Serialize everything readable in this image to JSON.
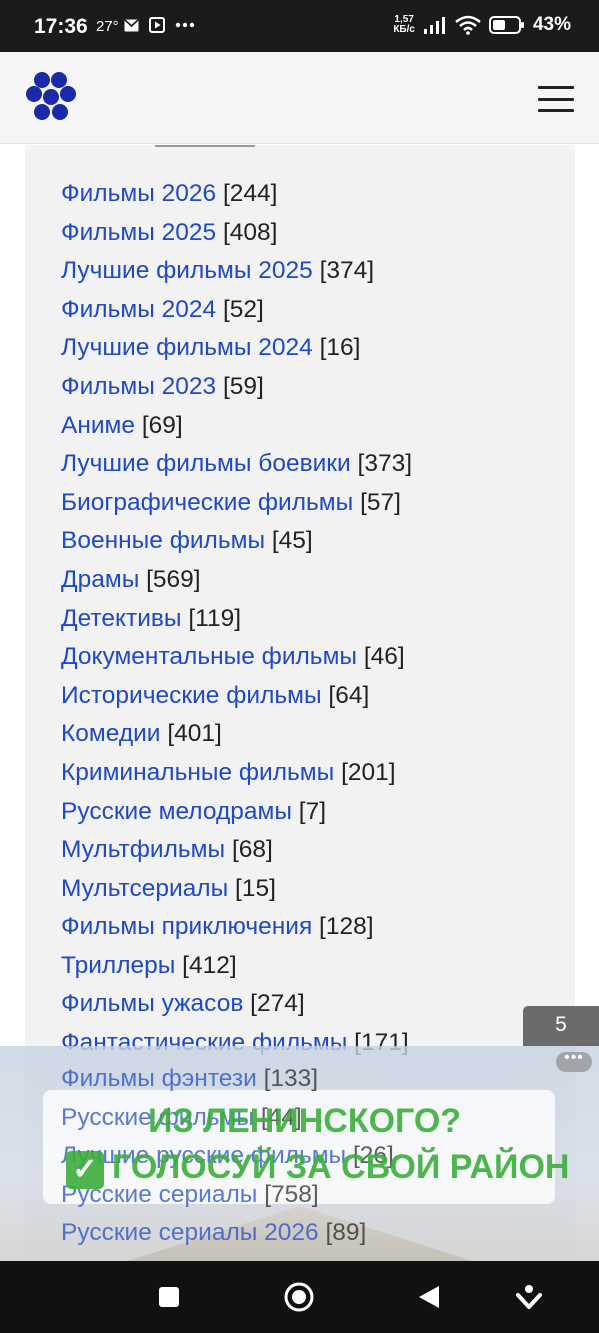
{
  "status_bar": {
    "time": "17:36",
    "temperature": "27°",
    "speed_value": "1,57",
    "speed_unit": "КБ/с",
    "battery_pct": "43%"
  },
  "header": {
    "logo_icon": "flower-logo-icon",
    "menu_icon": "hamburger-menu-icon"
  },
  "categories": [
    {
      "label": "Фильмы 2026",
      "count": "[244]"
    },
    {
      "label": "Фильмы 2025",
      "count": "[408]"
    },
    {
      "label": "Лучшие фильмы 2025",
      "count": "[374]"
    },
    {
      "label": "Фильмы 2024",
      "count": "[52]"
    },
    {
      "label": "Лучшие фильмы 2024",
      "count": "[16]"
    },
    {
      "label": "Фильмы 2023",
      "count": "[59]"
    },
    {
      "label": "Аниме",
      "count": "[69]"
    },
    {
      "label": "Лучшие фильмы боевики",
      "count": "[373]"
    },
    {
      "label": "Биографические фильмы",
      "count": "[57]"
    },
    {
      "label": "Военные фильмы",
      "count": "[45]"
    },
    {
      "label": "Драмы",
      "count": "[569]"
    },
    {
      "label": "Детективы",
      "count": "[119]"
    },
    {
      "label": "Документальные фильмы",
      "count": "[46]"
    },
    {
      "label": "Исторические фильмы",
      "count": "[64]"
    },
    {
      "label": "Комедии",
      "count": "[401]"
    },
    {
      "label": "Криминальные фильмы",
      "count": "[201]"
    },
    {
      "label": "Русские мелодрамы",
      "count": "[7]"
    },
    {
      "label": "Мультфильмы",
      "count": "[68]"
    },
    {
      "label": "Мультсериалы",
      "count": "[15]"
    },
    {
      "label": "Фильмы приключения",
      "count": "[128]"
    },
    {
      "label": "Триллеры",
      "count": "[412]"
    },
    {
      "label": "Фильмы ужасов",
      "count": "[274]"
    },
    {
      "label": "Фантастические фильмы",
      "count": "[171]"
    },
    {
      "label": "Фильмы фэнтези",
      "count": "[133]"
    },
    {
      "label": "Русские фильмы",
      "count": "[44]"
    },
    {
      "label": "Лучшие русские фильмы",
      "count": "[26]"
    },
    {
      "label": "Русские сериалы",
      "count": "[758]"
    },
    {
      "label": "Русские сериалы 2026",
      "count": "[89]"
    }
  ],
  "page_badge": "5",
  "ad": {
    "line1": "ИЗ ЛЕНИНСКОГО?",
    "line2": "ГОЛОСУЙ ЗА СВОЙ РАЙОН",
    "more_label": "•••"
  },
  "colors": {
    "link": "#1f49c6",
    "count_text": "#222222",
    "panel_bg": "#f2f2f2",
    "ad_green": "#3cae3c"
  }
}
